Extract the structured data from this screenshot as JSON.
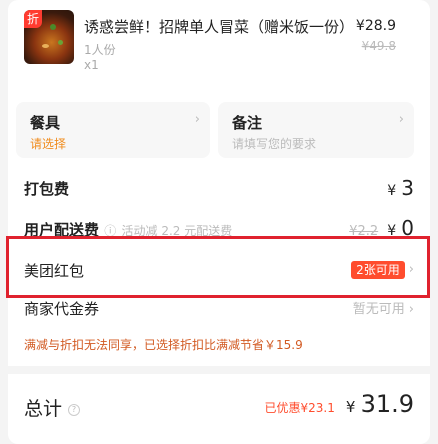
{
  "product": {
    "badge": "折",
    "title": "诱惑尝鲜！招牌单人冒菜（赠米饭一份）",
    "spec": "1人份",
    "quantity": "x1",
    "price": "¥28.9",
    "original_price": "¥49.8"
  },
  "options": {
    "utensils": {
      "title": "餐具",
      "value": "请选择"
    },
    "remark": {
      "title": "备注",
      "placeholder": "请填写您的要求"
    }
  },
  "fees": {
    "packing_label": "打包费",
    "packing_yen": "¥",
    "packing_value": "3",
    "delivery_label": "用户配送费",
    "delivery_note": "活动减 2.2 元配送费",
    "delivery_original": "¥2.2",
    "delivery_yen": "¥",
    "delivery_value": "0"
  },
  "red_packet": {
    "label": "美团红包",
    "badge": "2张可用"
  },
  "voucher": {
    "label": "商家代金券",
    "status": "暂无可用"
  },
  "warning": "满减与折扣无法同享，已选择折扣比满减节省￥15.9",
  "total": {
    "label": "总计",
    "saved": "已优惠¥23.1",
    "yen": "¥",
    "value": "31.9"
  },
  "colors": {
    "accent": "#ff4d2e",
    "highlight_border": "#e0222e",
    "warning_text": "#d25a22"
  }
}
